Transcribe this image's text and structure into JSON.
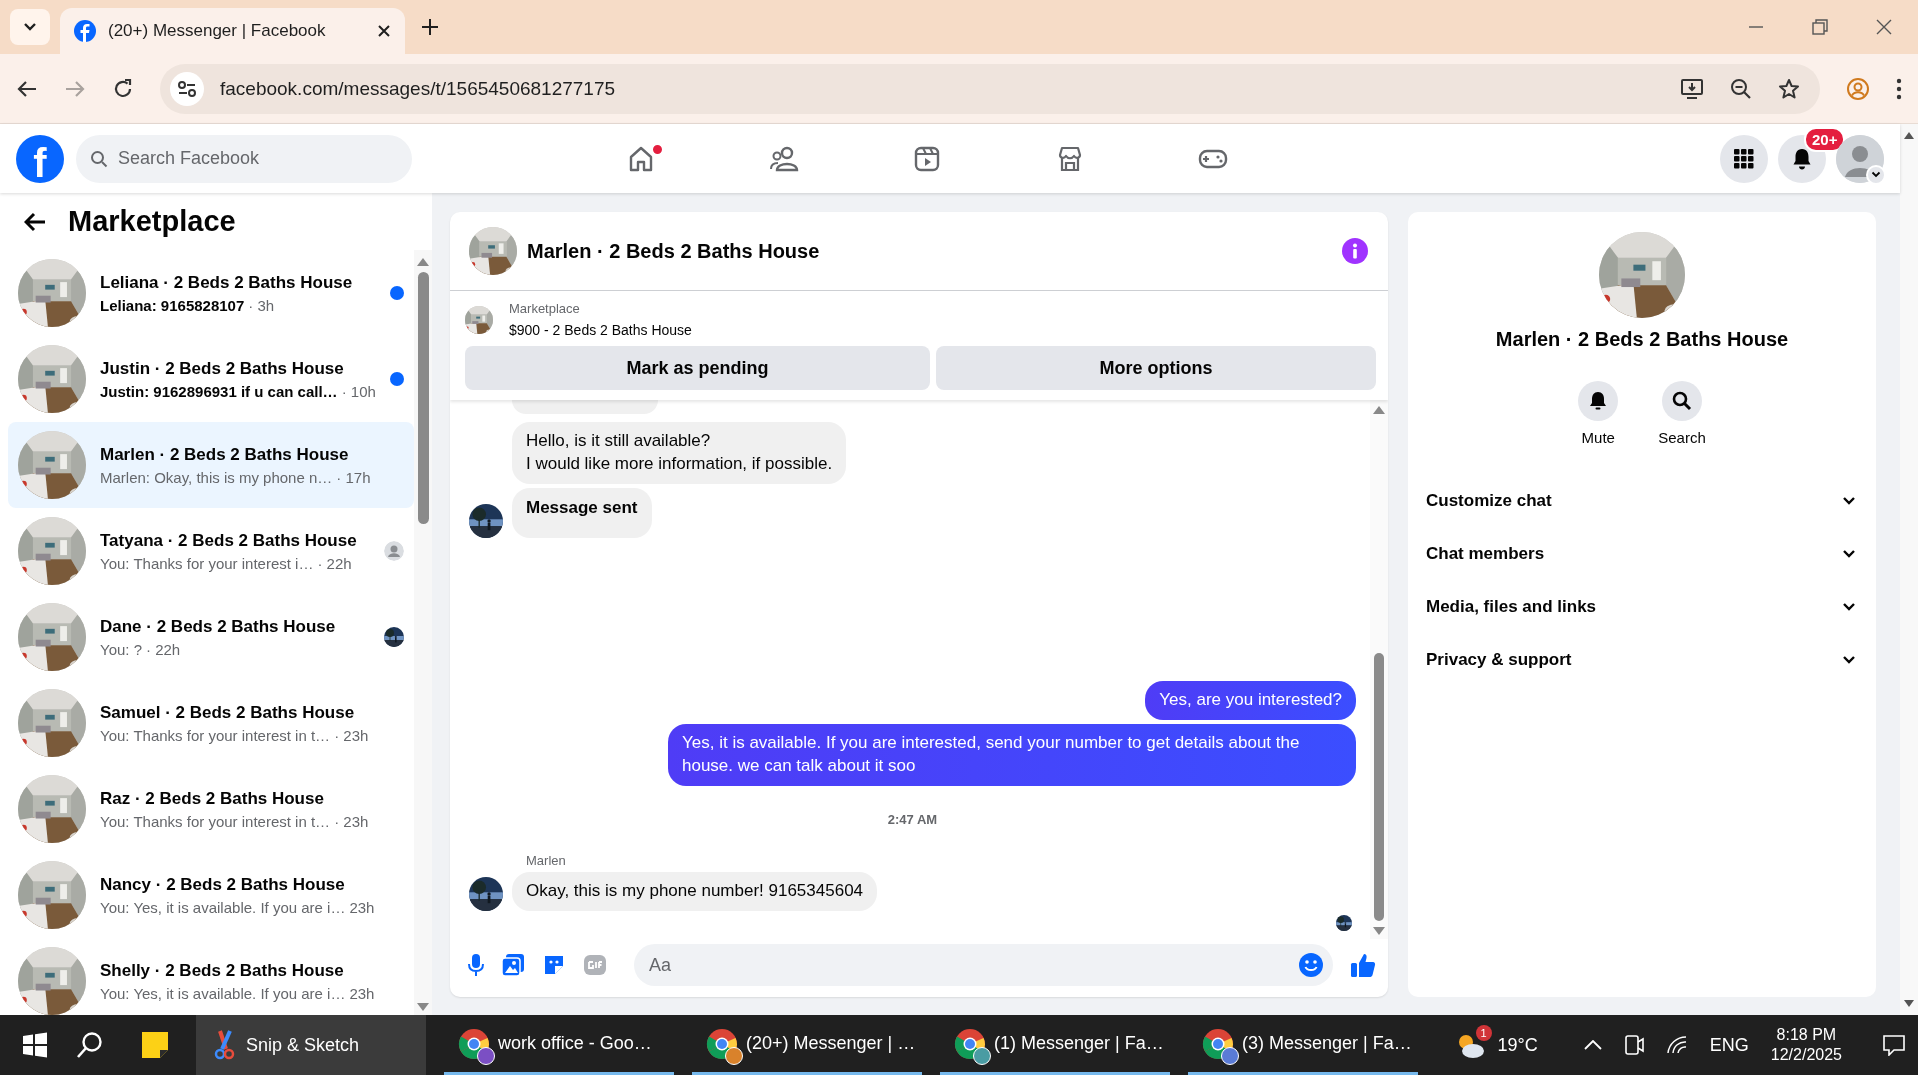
{
  "browser": {
    "tab_title": "(20+) Messenger | Facebook",
    "url": "facebook.com/messages/t/1565450681277175"
  },
  "facebook_header": {
    "logo": "f",
    "search": {
      "placeholder": "Search Facebook"
    },
    "nav": [
      {
        "kind": "home",
        "dot": true
      },
      {
        "kind": "friends",
        "dot": false
      },
      {
        "kind": "video",
        "dot": false
      },
      {
        "kind": "marketplace",
        "dot": false
      },
      {
        "kind": "gaming",
        "dot": false
      }
    ],
    "notification_badge": "20+"
  },
  "sidebar": {
    "title": "Marketplace",
    "conversations": [
      {
        "name": "Leliana · 2 Beds 2 Baths House",
        "preview": "Leliana: 9165828107",
        "time": "· 3h",
        "unread": true,
        "selected": false,
        "kind": "plain"
      },
      {
        "name": "Justin · 2 Beds 2 Baths House",
        "preview": "Justin: 9162896931 if u can call…",
        "time": "· 10h",
        "unread": true,
        "selected": false,
        "kind": "plain"
      },
      {
        "name": "Marlen · 2 Beds 2 Baths House",
        "preview": "Marlen: Okay, this is my phone n…",
        "time": "· 17h",
        "unread": false,
        "selected": true,
        "kind": "plain"
      },
      {
        "name": "Tatyana · 2 Beds 2 Baths House",
        "preview": "You: Thanks for your interest i…",
        "time": "· 22h",
        "unread": false,
        "selected": false,
        "kind": "seen-generic"
      },
      {
        "name": "Dane · 2 Beds 2 Baths House",
        "preview": "You: ?",
        "time": "· 22h",
        "unread": false,
        "selected": false,
        "kind": "seen-photo"
      },
      {
        "name": "Samuel · 2 Beds 2 Baths House",
        "preview": "You: Thanks for your interest in t…",
        "time": "· 23h",
        "unread": false,
        "selected": false,
        "kind": "plain"
      },
      {
        "name": "Raz · 2 Beds 2 Baths House",
        "preview": "You: Thanks for your interest in t…",
        "time": "· 23h",
        "unread": false,
        "selected": false,
        "kind": "plain"
      },
      {
        "name": "Nancy · 2 Beds 2 Baths House",
        "preview": "You: Yes, it is available. If you are i…",
        "time": "23h",
        "unread": false,
        "selected": false,
        "kind": "plain"
      },
      {
        "name": "Shelly · 2 Beds 2 Baths House",
        "preview": "You: Yes, it is available. If you are i…",
        "time": "23h",
        "unread": false,
        "selected": false,
        "kind": "plain"
      }
    ]
  },
  "chat": {
    "title": "Marlen · 2 Beds 2 Baths House",
    "listing": {
      "label": "Marketplace",
      "title": "$900 - 2 Beds 2 Baths House"
    },
    "actions": [
      "Mark as pending",
      "More options"
    ],
    "messages": [
      {
        "kind": "incoming",
        "text": "Hello, is it still available?\nI would like more information, if possible.",
        "avatar": false,
        "bold": false
      },
      {
        "kind": "incoming",
        "text": "Message sent",
        "avatar": true,
        "bold": true
      },
      {
        "kind": "outgoing",
        "text": "Yes, are you interested?"
      },
      {
        "kind": "outgoing",
        "text": "Yes, it is available. If you are interested, send your number to get details about the house. we can talk about it soo"
      },
      {
        "kind": "timestamp",
        "text": "2:47 AM"
      },
      {
        "kind": "sender",
        "text": "Marlen"
      },
      {
        "kind": "incoming",
        "text": "Okay, this is my phone number! 9165345604",
        "avatar": true,
        "bold": false
      },
      {
        "kind": "seen"
      }
    ],
    "composer": {
      "placeholder": "Aa"
    }
  },
  "details": {
    "title": "Marlen · 2 Beds 2 Baths House",
    "actions": [
      {
        "kind": "mute",
        "label": "Mute"
      },
      {
        "kind": "search",
        "label": "Search"
      }
    ],
    "sections": [
      {
        "label": "Customize chat",
        "expanded": false
      },
      {
        "label": "Chat members",
        "expanded": false
      },
      {
        "label": "Media, files and links",
        "expanded": false
      },
      {
        "label": "Privacy & support",
        "expanded": false
      }
    ]
  },
  "taskbar": {
    "apps": [
      {
        "kind": "snip",
        "label": "Snip & Sketch",
        "selected": true
      },
      {
        "kind": "chrome",
        "label": "work office - Goo…",
        "selected": false,
        "color": "#7b4fc4"
      },
      {
        "kind": "chrome",
        "label": "(20+) Messenger | …",
        "selected": false,
        "color": "#d9822b"
      },
      {
        "kind": "chrome",
        "label": "(1) Messenger | Fa…",
        "selected": false,
        "color": "#4a9ca3"
      },
      {
        "kind": "chrome",
        "label": "(3) Messenger | Fa…",
        "selected": false,
        "color": "#5a7bd6"
      }
    ],
    "weather": {
      "badge": "1",
      "temperature": "19°C"
    },
    "language": "ENG",
    "time": "8:18 PM",
    "date": "12/2/2025"
  }
}
